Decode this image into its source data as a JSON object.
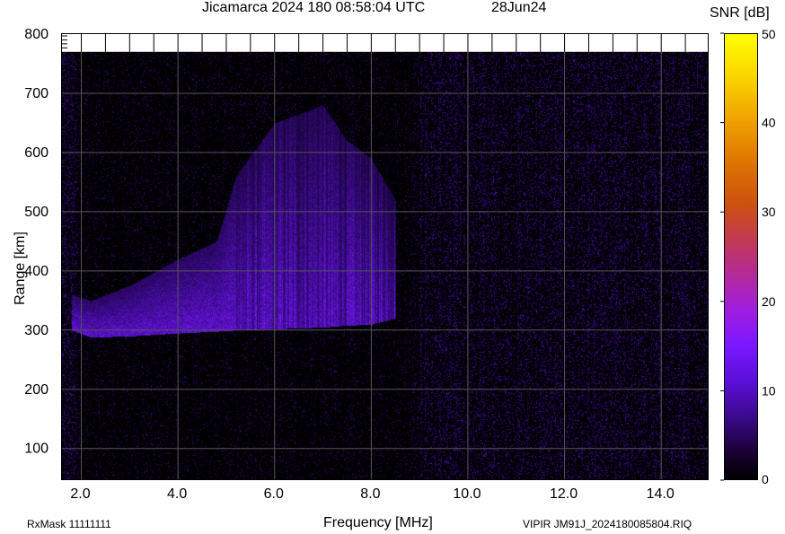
{
  "header": {
    "title": "Jicamarca 2024 180 08:58:04 UTC",
    "date": "28Jun24",
    "colorbar_label": "SNR [dB]"
  },
  "footer": {
    "rxmask": "RxMask 11111111",
    "filename": "VIPIR  JM91J_2024180085804.RIQ"
  },
  "chart_data": {
    "type": "heatmap",
    "title": "Jicamarca 2024 180 08:58:04 UTC",
    "xlabel": "Frequency [MHz]",
    "ylabel": "Range [km]",
    "xlim": [
      1.6,
      15.0
    ],
    "ylim": [
      45,
      800
    ],
    "data_range_max": 770,
    "x_ticks": [
      "2.0",
      "4.0",
      "6.0",
      "8.0",
      "10.0",
      "12.0",
      "14.0"
    ],
    "x_tick_values": [
      2,
      4,
      6,
      8,
      10,
      12,
      14
    ],
    "y_ticks": [
      "100",
      "200",
      "300",
      "400",
      "500",
      "600",
      "700",
      "800"
    ],
    "y_tick_values": [
      100,
      200,
      300,
      400,
      500,
      600,
      700,
      800
    ],
    "grid": true,
    "colorbar": {
      "label": "SNR [dB]",
      "range": [
        0,
        50
      ],
      "ticks": [
        "0",
        "10",
        "20",
        "30",
        "40",
        "50"
      ],
      "tick_values": [
        0,
        10,
        20,
        30,
        40,
        50
      ],
      "colormap": [
        "#000000",
        "#3a0a8a",
        "#7a18ff",
        "#b42a98",
        "#cc5210",
        "#f2a800",
        "#ffff00"
      ]
    },
    "trace": {
      "description_points": [
        {
          "f": 1.8,
          "h_low": 300,
          "h_high": 360
        },
        {
          "f": 2.2,
          "h_low": 288,
          "h_high": 350
        },
        {
          "f": 3.0,
          "h_low": 290,
          "h_high": 375
        },
        {
          "f": 4.0,
          "h_low": 295,
          "h_high": 420
        },
        {
          "f": 4.8,
          "h_low": 298,
          "h_high": 450
        },
        {
          "f": 5.2,
          "h_low": 300,
          "h_high": 560
        },
        {
          "f": 6.0,
          "h_low": 302,
          "h_high": 650
        },
        {
          "f": 7.0,
          "h_low": 305,
          "h_high": 680
        },
        {
          "f": 7.5,
          "h_low": 308,
          "h_high": 620
        },
        {
          "f": 8.0,
          "h_low": 310,
          "h_high": 590
        },
        {
          "f": 8.5,
          "h_low": 320,
          "h_high": 520
        }
      ],
      "snr_db": 15
    }
  }
}
